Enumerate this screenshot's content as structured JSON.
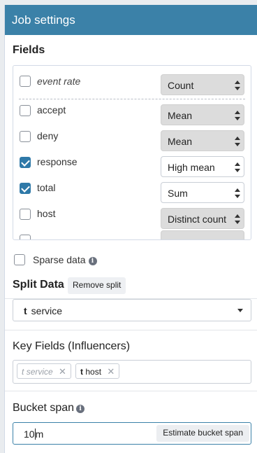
{
  "header": {
    "title": "Job settings"
  },
  "fields": {
    "title": "Fields",
    "items": [
      {
        "label": "event rate",
        "checked": false,
        "italic": true,
        "function": "Count",
        "select_style": "grey"
      },
      {
        "label": "accept",
        "checked": false,
        "italic": false,
        "function": "Mean",
        "select_style": "grey"
      },
      {
        "label": "deny",
        "checked": false,
        "italic": false,
        "function": "Mean",
        "select_style": "grey"
      },
      {
        "label": "response",
        "checked": true,
        "italic": false,
        "function": "High mean",
        "select_style": "white"
      },
      {
        "label": "total",
        "checked": true,
        "italic": false,
        "function": "Sum",
        "select_style": "white"
      },
      {
        "label": "host",
        "checked": false,
        "italic": false,
        "function": "Distinct count",
        "select_style": "grey"
      }
    ],
    "sparse_label": "Sparse data"
  },
  "split": {
    "title": "Split Data",
    "remove_label": "Remove split",
    "type_badge": "t",
    "selected": "service"
  },
  "key_fields": {
    "title": "Key Fields (Influencers)",
    "pills": [
      {
        "badge": "t",
        "label": "service",
        "muted": true
      },
      {
        "badge": "t",
        "label": "host",
        "muted": false
      }
    ],
    "remove_glyph": "✕"
  },
  "bucket": {
    "title": "Bucket span",
    "value_before_cursor": "10",
    "value_after_cursor": "m",
    "estimate_label": "Estimate bucket span"
  },
  "colors": {
    "header_bg": "#3b81a8",
    "checkbox_checked": "#2f79a8"
  }
}
